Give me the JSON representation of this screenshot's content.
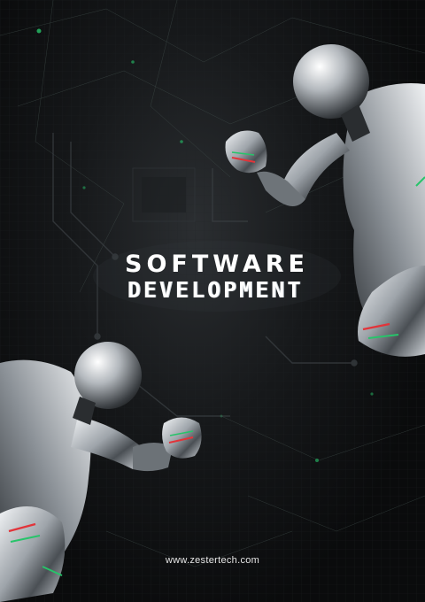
{
  "poster": {
    "title_line1": "SOFTWARE",
    "title_line2": "DEVELOPMENT",
    "website": "www.zestertech.com"
  },
  "colors": {
    "background": "#0b0c0d",
    "title": "#ffffff",
    "robot_chrome": "#b9bec3",
    "accent_green": "#27c46a",
    "accent_red": "#e2343a"
  }
}
